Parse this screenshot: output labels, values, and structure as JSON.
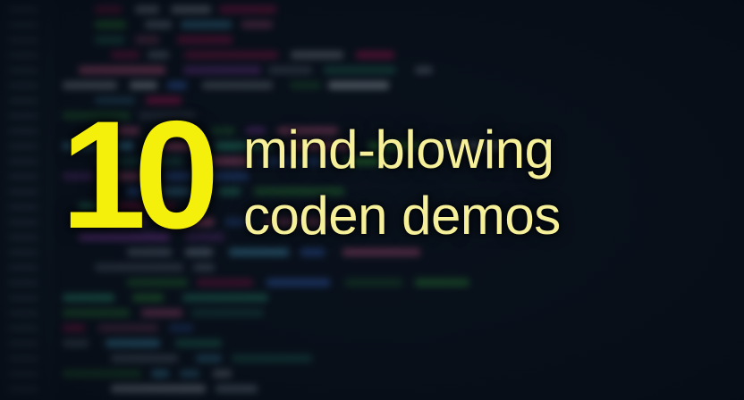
{
  "headline": {
    "number": "10",
    "line1": "mind-blowing",
    "line2": "coden demos"
  },
  "colors": {
    "background": "#0b1420",
    "number": "#f4ef0b",
    "title": "#f6f09a"
  }
}
